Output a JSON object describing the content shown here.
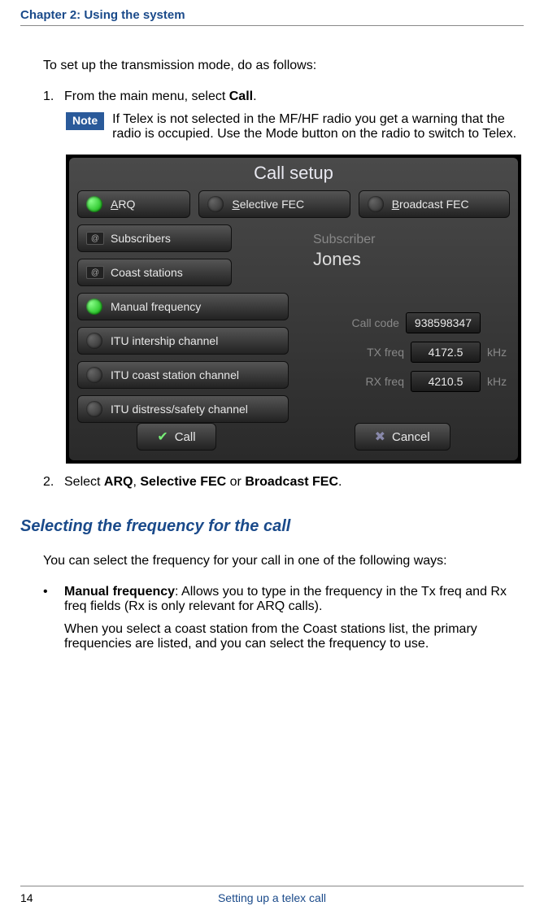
{
  "chapter_header": "Chapter 2:  Using the system",
  "intro": "To set up the transmission mode, do as follows:",
  "step1": {
    "num": "1.",
    "prefix": "From the main menu, select ",
    "bold": "Call",
    "suffix": "."
  },
  "note": {
    "badge": "Note",
    "text": "If Telex is not selected in the MF/HF radio you get a warning that the radio is occupied. Use the Mode button on the radio to switch to Telex."
  },
  "screenshot": {
    "title": "Call setup",
    "top_buttons": [
      {
        "ul": "A",
        "rest": "RQ",
        "on": true
      },
      {
        "ul": "S",
        "rest": "elective FEC",
        "on": false
      },
      {
        "ul": "B",
        "rest": "roadcast FEC",
        "on": false
      }
    ],
    "side_buttons": [
      {
        "icon": "@",
        "ul": "S",
        "rest": "ubscribers"
      },
      {
        "icon": "@",
        "ul": "C",
        "rest": "oast stations"
      }
    ],
    "subscriber_label": "Subscriber",
    "subscriber_name": "Jones",
    "left_buttons": [
      {
        "ul": "M",
        "rest": "anual frequency",
        "on": true
      },
      {
        "pre": "ITU ",
        "ul": "i",
        "rest": "ntership channel",
        "on": false
      },
      {
        "pre": "I",
        "ul": "T",
        "rest": "U coast station channel",
        "on": false
      },
      {
        "pre": "ITU ",
        "ul": "d",
        "rest": "istress/safety channel",
        "on": false
      }
    ],
    "fields": {
      "call_code": {
        "label": "Call code",
        "value": "938598347"
      },
      "tx": {
        "label": "TX freq",
        "value": "4172.5",
        "unit": "kHz"
      },
      "rx": {
        "label": "RX freq",
        "value": "4210.5",
        "unit": "kHz"
      }
    },
    "call_btn": "Call",
    "cancel_btn": {
      "ul": "C",
      "rest": "ancel"
    }
  },
  "step2": {
    "num": "2.",
    "prefix": "Select ",
    "b1": "ARQ",
    "sep1": ", ",
    "b2": "Selective FEC",
    "sep2": " or ",
    "b3": "Broadcast FEC",
    "suffix": "."
  },
  "section_heading": "Selecting the frequency for the call",
  "section_intro": "You can select the frequency for your call in one of the following ways:",
  "bullet": {
    "mark": "•",
    "bold": "Manual frequency",
    "text": ": Allows you to type in the frequency in the Tx freq and Rx freq fields (Rx is only relevant for ARQ calls).",
    "cont": "When you select a coast station from the Coast stations list, the primary frequencies are listed, and you can select the frequency to use."
  },
  "footer": {
    "page": "14",
    "title": "Setting up a telex call"
  }
}
